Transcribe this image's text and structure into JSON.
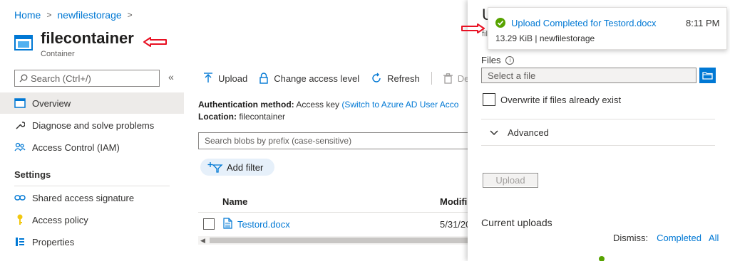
{
  "breadcrumb": {
    "home": "Home",
    "storage": "newfilestorage"
  },
  "header": {
    "title": "filecontainer",
    "subtitle": "Container"
  },
  "sidebar": {
    "search_placeholder": "Search (Ctrl+/)",
    "collapse": "«",
    "items": [
      {
        "label": "Overview",
        "icon": "overview-icon",
        "selected": true
      },
      {
        "label": "Diagnose and solve problems",
        "icon": "wrench-icon"
      },
      {
        "label": "Access Control (IAM)",
        "icon": "people-icon"
      }
    ],
    "settings_heading": "Settings",
    "settings_items": [
      {
        "label": "Shared access signature",
        "icon": "link-icon"
      },
      {
        "label": "Access policy",
        "icon": "key-icon"
      },
      {
        "label": "Properties",
        "icon": "properties-icon"
      }
    ]
  },
  "toolbar": {
    "upload": "Upload",
    "change_access": "Change access level",
    "refresh": "Refresh",
    "delete": "Dele"
  },
  "info": {
    "auth_label": "Authentication method:",
    "auth_value": "Access key",
    "auth_link": "(Switch to Azure AD User Acco",
    "location_label": "Location:",
    "location_value": "filecontainer"
  },
  "blob_search_placeholder": "Search blobs by prefix (case-sensitive)",
  "add_filter": "Add filter",
  "table": {
    "columns": [
      "Name",
      "Modifi"
    ],
    "rows": [
      {
        "name": "Testord.docx",
        "modified": "5/31/20"
      }
    ]
  },
  "upload_panel": {
    "title_fragment": "U",
    "subtitle_fragment": "fil",
    "close": "✕",
    "files_label": "Files",
    "info_glyph": "i",
    "file_placeholder": "Select a file",
    "overwrite_label": "Overwrite if files already exist",
    "advanced_label": "Advanced",
    "upload_button": "Upload",
    "current_uploads": "Current uploads",
    "dismiss_label": "Dismiss:",
    "dismiss_completed": "Completed",
    "dismiss_all": "All"
  },
  "notification": {
    "title": "Upload Completed for Testord.docx",
    "time": "8:11 PM",
    "detail": "13.29 KiB | newfilestorage"
  },
  "colors": {
    "accent": "#0078d4",
    "success": "#57a300",
    "annotation": "#e81123"
  }
}
